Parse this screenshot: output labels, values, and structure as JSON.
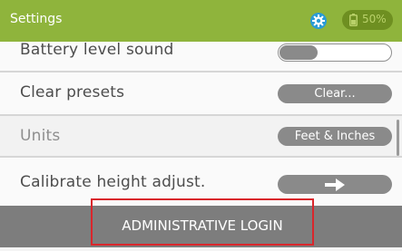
{
  "header": {
    "title": "Settings",
    "settings_icon": "gear-icon",
    "battery_icon": "battery-icon",
    "battery_percent": "50%",
    "accent_color": "#8fb43c"
  },
  "settings": [
    {
      "label": "Battery level sound",
      "control": "toggle",
      "toggle_state": "off"
    },
    {
      "label": "Clear presets",
      "control": "button",
      "value": "Clear..."
    },
    {
      "label": "Units",
      "control": "button",
      "value": "Feet & Inches",
      "disabled": true
    },
    {
      "label": "Calibrate height adjust.",
      "control": "button",
      "icon": "right-arrow-icon"
    }
  ],
  "footer": {
    "admin_label": "ADMINISTRATIVE LOGIN",
    "highlight_color": "#d9262c"
  }
}
